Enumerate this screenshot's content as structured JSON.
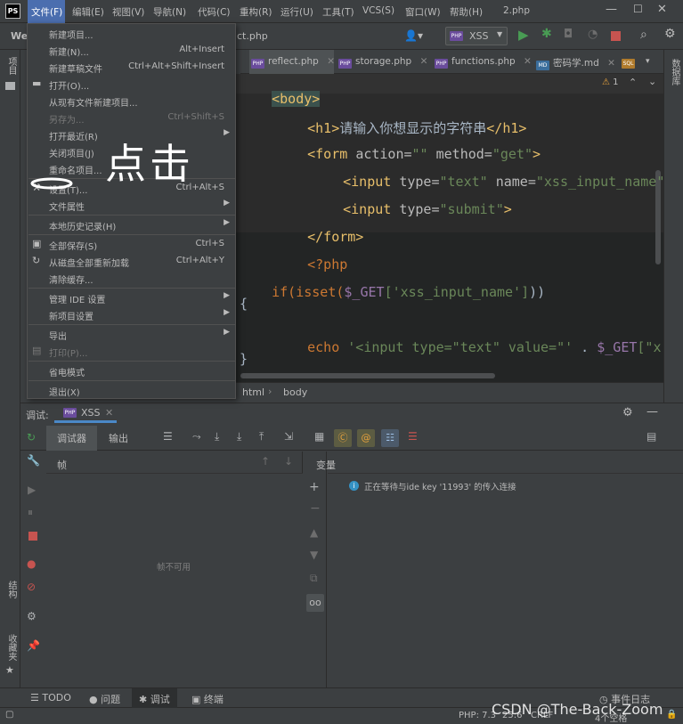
{
  "app": {
    "logo": "PS",
    "file_name": "2.php",
    "project_trunc": "We",
    "file_trunc": "ct.php"
  },
  "menubar": [
    {
      "label": "文件(F)"
    },
    {
      "label": "编辑(E)"
    },
    {
      "label": "视图(V)"
    },
    {
      "label": "导航(N)"
    },
    {
      "label": "代码(C)"
    },
    {
      "label": "重构(R)"
    },
    {
      "label": "运行(U)"
    },
    {
      "label": "工具(T)"
    },
    {
      "label": "VCS(S)"
    },
    {
      "label": "窗口(W)"
    },
    {
      "label": "帮助(H)"
    }
  ],
  "toolbar": {
    "run_config": "XSS"
  },
  "tabs": [
    {
      "label": "reflect.php"
    },
    {
      "label": "storage.php"
    },
    {
      "label": "functions.php"
    },
    {
      "label": "密码学.md"
    }
  ],
  "file_menu": {
    "items": [
      {
        "label": "新建项目...",
        "shortcut": ""
      },
      {
        "label": "新建(N)...",
        "shortcut": "Alt+Insert"
      },
      {
        "label": "新建草稿文件",
        "shortcut": "Ctrl+Alt+Shift+Insert"
      },
      {
        "label": "打开(O)...",
        "shortcut": ""
      },
      {
        "label": "从现有文件新建项目...",
        "shortcut": ""
      },
      {
        "label": "另存为...",
        "shortcut": "Ctrl+Shift+S"
      },
      {
        "label": "打开最近(R)",
        "shortcut": ""
      },
      {
        "label": "关闭项目(J)",
        "shortcut": ""
      },
      {
        "label": "重命名项目...",
        "shortcut": ""
      },
      {
        "label": "设置(T)...",
        "shortcut": "Ctrl+Alt+S"
      },
      {
        "label": "文件属性",
        "shortcut": ""
      },
      {
        "label": "本地历史记录(H)",
        "shortcut": ""
      },
      {
        "label": "全部保存(S)",
        "shortcut": "Ctrl+S"
      },
      {
        "label": "从磁盘全部重新加载",
        "shortcut": "Ctrl+Alt+Y"
      },
      {
        "label": "清除缓存...",
        "shortcut": ""
      },
      {
        "label": "管理 IDE 设置",
        "shortcut": ""
      },
      {
        "label": "新项目设置",
        "shortcut": ""
      },
      {
        "label": "导出",
        "shortcut": ""
      },
      {
        "label": "打印(P)...",
        "shortcut": ""
      },
      {
        "label": "省电模式",
        "shortcut": ""
      },
      {
        "label": "退出(X)",
        "shortcut": ""
      }
    ]
  },
  "annotation": {
    "text": "点击"
  },
  "editor": {
    "warning_count": "1",
    "lines": {
      "l1_tag": "<body>",
      "l2_open": "<h1>",
      "l2_text": "请输入你想显示的字符串",
      "l2_close": "</h1>",
      "l3_tag": "<form ",
      "l3_a1": "action=",
      "l3_v1": "\"\"",
      "l3_a2": " method=",
      "l3_v2": "\"get\"",
      "l3_end": ">",
      "l4_tag": "<input ",
      "l4_a1": "type=",
      "l4_v1": "\"text\"",
      "l4_a2": " name=",
      "l4_v2": "\"xss_input_name\"",
      "l5_tag": "<input ",
      "l5_a1": "type=",
      "l5_v1": "\"submit\"",
      "l5_end": ">",
      "l6_tag": "</form>",
      "l7_tag": "<?php",
      "l8_kw": "if(isset(",
      "l8_var": "$_GET",
      "l8_str": "['xss_input_name']",
      "l8_end": "))",
      "l9": "{",
      "l10_kw": "echo ",
      "l10_str": "'<input type=\"text\" value=\"'",
      "l10_mid": " . ",
      "l10_var": "$_GET",
      "l10_rest": "[\"x",
      "l11": "}"
    }
  },
  "breadcrumb": {
    "item1": "html",
    "item2": "body"
  },
  "left_stripe": {
    "project": "项目",
    "structure": "结构",
    "favorites": "收藏夹"
  },
  "right_stripe": {
    "database": "数据库"
  },
  "debug": {
    "title": "调试:",
    "session": "XSS",
    "tab_debugger": "调试器",
    "tab_output": "输出",
    "frames_header": "帧",
    "vars_header": "变量",
    "frames_empty": "帧不可用",
    "waiting_msg": "正在等待与ide key '11993' 的传入连接"
  },
  "statusbar": {
    "todo": "TODO",
    "problems": "问题",
    "debug": "调试",
    "terminal": "终端",
    "events": "事件日志",
    "php": "PHP: 7.3",
    "pos": "25:6",
    "crlf": "CRLF",
    "indent": "4个空格",
    "watermark": "CSDN @The-Back-Zoom"
  }
}
